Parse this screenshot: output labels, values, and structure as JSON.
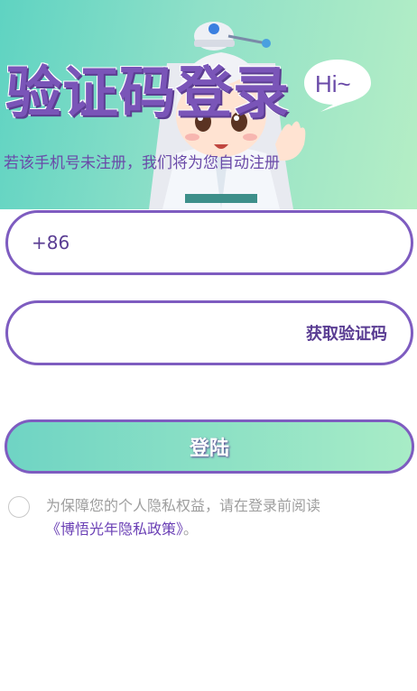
{
  "hero": {
    "title": "验证码登录",
    "subtitle": "若该手机号未注册，我们将为您自动注册",
    "bubble": "Hi~"
  },
  "phone": {
    "prefix": "+86",
    "value": "",
    "placeholder": ""
  },
  "code": {
    "value": "",
    "placeholder": "",
    "get_code_label": "获取验证码"
  },
  "login": {
    "label": "登陆"
  },
  "agreement": {
    "checked": false,
    "text": "为保障您的个人隐私权益，请在登录前阅读",
    "policy_link": "《博悟光年隐私政策》",
    "suffix": "。"
  },
  "colors": {
    "accent": "#7e5cc0",
    "hero_start": "#5fd3c2",
    "hero_end": "#b5eec5",
    "link": "#6a3fb5"
  }
}
